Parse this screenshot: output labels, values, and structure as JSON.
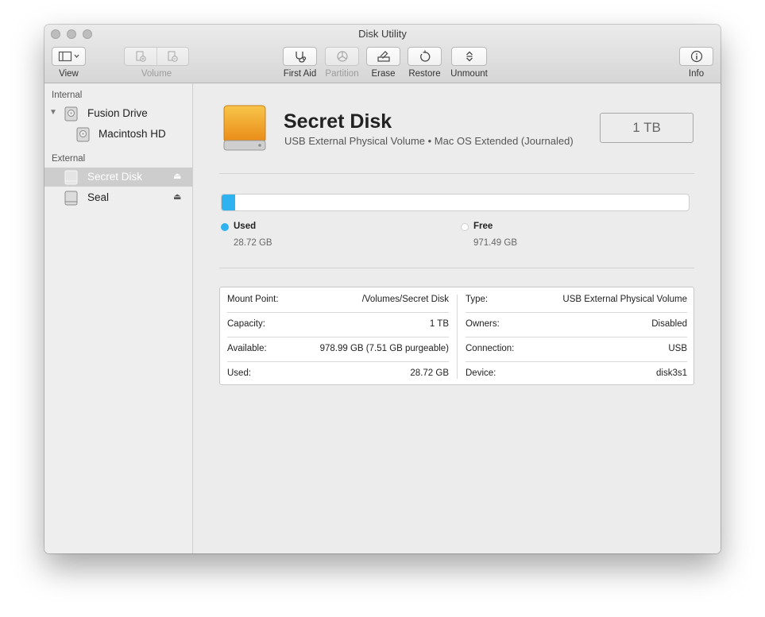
{
  "window": {
    "title": "Disk Utility"
  },
  "toolbar": {
    "view_label": "View",
    "volume_label": "Volume",
    "first_aid_label": "First Aid",
    "partition_label": "Partition",
    "erase_label": "Erase",
    "restore_label": "Restore",
    "unmount_label": "Unmount",
    "info_label": "Info"
  },
  "sidebar": {
    "internal_header": "Internal",
    "external_header": "External",
    "internal_items": [
      "Fusion Drive",
      "Macintosh HD"
    ],
    "external_items": [
      "Secret Disk",
      "Seal"
    ],
    "selected": "Secret Disk"
  },
  "disk": {
    "name": "Secret Disk",
    "subtitle": "USB External Physical Volume • Mac OS Extended (Journaled)",
    "size_badge": "1 TB"
  },
  "usage": {
    "used_label": "Used",
    "used_value": "28.72 GB",
    "free_label": "Free",
    "free_value": "971.49 GB",
    "used_fraction": 0.029,
    "used_color": "#2fb3f0",
    "free_color": "#ffffff"
  },
  "info": {
    "left": [
      {
        "label": "Mount Point:",
        "value": "/Volumes/Secret Disk"
      },
      {
        "label": "Capacity:",
        "value": "1 TB"
      },
      {
        "label": "Available:",
        "value": "978.99 GB (7.51 GB purgeable)"
      },
      {
        "label": "Used:",
        "value": "28.72 GB"
      }
    ],
    "right": [
      {
        "label": "Type:",
        "value": "USB External Physical Volume"
      },
      {
        "label": "Owners:",
        "value": "Disabled"
      },
      {
        "label": "Connection:",
        "value": "USB"
      },
      {
        "label": "Device:",
        "value": "disk3s1"
      }
    ]
  }
}
